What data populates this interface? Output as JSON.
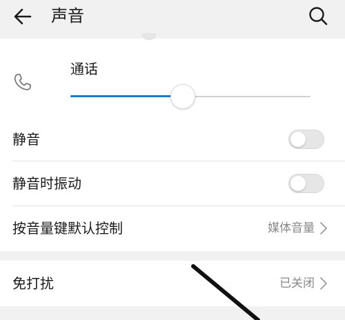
{
  "header": {
    "title": "声音"
  },
  "call": {
    "label": "通话",
    "volume_fraction": 0.465
  },
  "rows": {
    "mute": {
      "label": "静音",
      "checked": false
    },
    "vibrate_when_muted": {
      "label": "静音时振动",
      "checked": false
    },
    "volume_key_default": {
      "label": "按音量键默认控制",
      "value": "媒体音量"
    }
  },
  "dnd": {
    "label": "免打扰",
    "value": "已关闭"
  },
  "colors": {
    "accent": "#1976d2",
    "background": "#f1f1f1",
    "card": "#ffffff",
    "secondary_text": "#888888"
  },
  "icons": {
    "back": "back-arrow-icon",
    "search": "search-icon",
    "phone": "phone-icon",
    "chevron": "chevron-right-icon"
  }
}
